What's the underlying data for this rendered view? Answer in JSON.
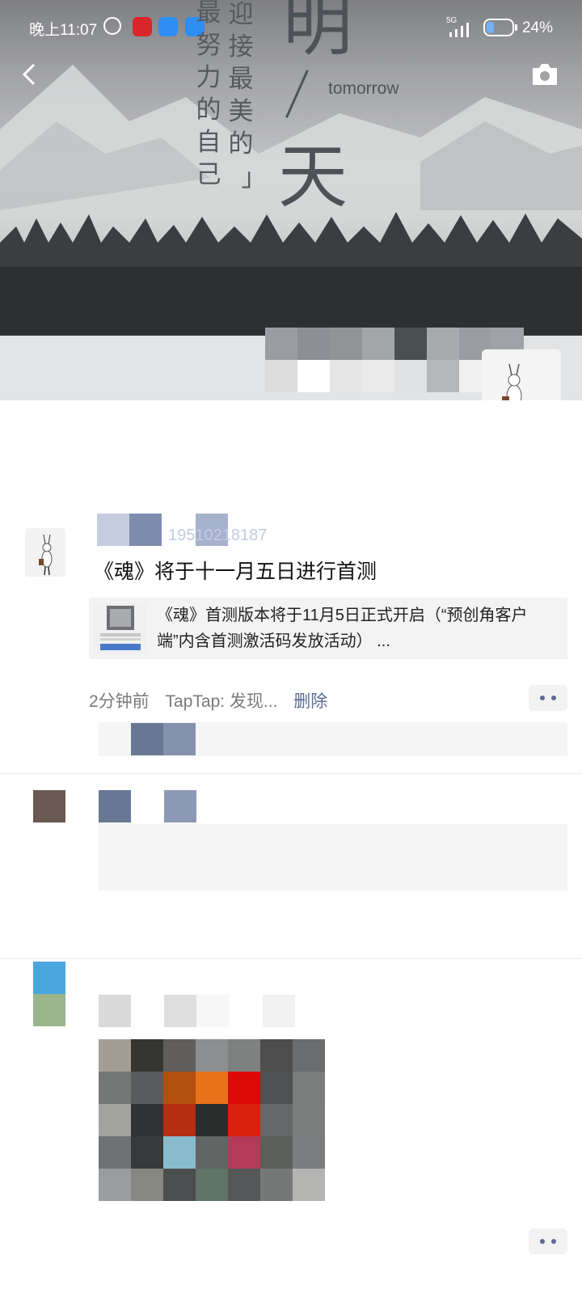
{
  "status_bar": {
    "time": "晚上11:07",
    "network": "5G",
    "battery": "24%"
  },
  "header": {
    "back_icon": "chevron-left-icon",
    "camera_icon": "camera-icon"
  },
  "cover": {
    "poster_lines": [
      "最努力的自己",
      "迎接最美的",
      "」"
    ],
    "poster_big_1": "明",
    "poster_big_2": "天",
    "poster_tomorrow": "tomorrow"
  },
  "post_1": {
    "username": "19510218187",
    "text": "《魂》将于十一月五日进行首测",
    "share_title": "《魂》首测版本将于11月5日正式开启（“预创角客户端”内含首测激活码发放活动）  ...",
    "time": "2分钟前",
    "source": "TapTap: 发现...",
    "delete_label": "删除"
  },
  "colors": {
    "link": "#5b6b93",
    "meta": "#7a7a7a",
    "card_bg": "#f3f3f3"
  }
}
